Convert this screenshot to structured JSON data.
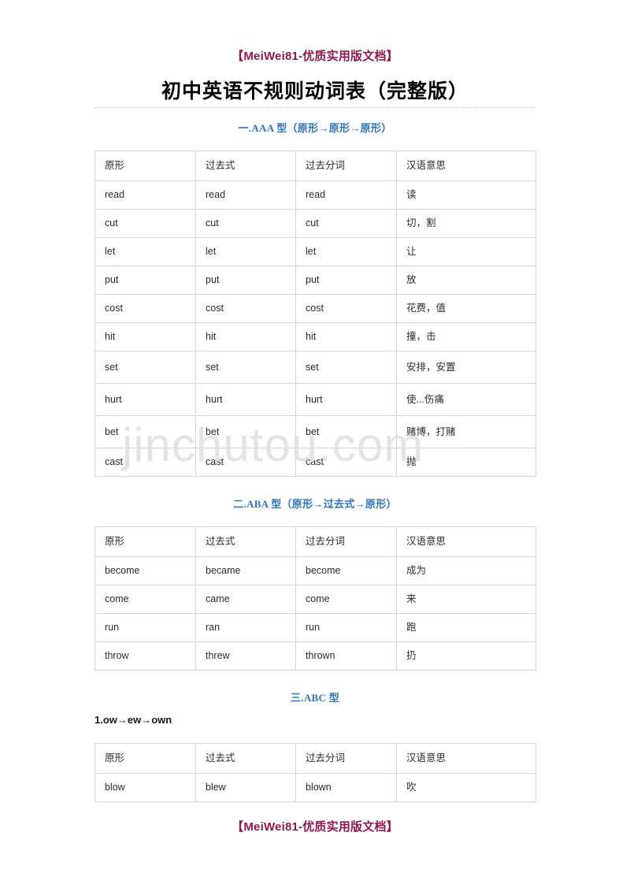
{
  "banner": {
    "top": "【MeiWei81-优质实用版文档】",
    "bottom": "【MeiWei81-优质实用版文档】"
  },
  "document": {
    "title": "初中英语不规则动词表（完整版）"
  },
  "watermark": {
    "text": "jinchutou.com",
    "color": "#e6e2e2"
  },
  "colors": {
    "banner": "#8C1A4F",
    "section_heading": "#2E74B5",
    "table_border": "#d4d4d4",
    "body_text": "#2b2b2b"
  },
  "table_headers": [
    "原形",
    "过去式",
    "过去分词",
    "汉语意思"
  ],
  "sections": [
    {
      "heading": "一.AAA 型（原形→原形→原形）",
      "subheading": null,
      "rows": [
        [
          "read",
          "read",
          "read",
          "读"
        ],
        [
          "cut",
          "cut",
          "cut",
          "切，割"
        ],
        [
          "let",
          "let",
          "let",
          "让"
        ],
        [
          "put",
          "put",
          "put",
          "放"
        ],
        [
          "cost",
          "cost",
          "cost",
          "花费，值"
        ],
        [
          "hit",
          "hit",
          "hit",
          "撞，击"
        ],
        [
          "set",
          "set",
          "set",
          "安排，安置"
        ],
        [
          "hurt",
          "hurt",
          "hurt",
          "使...伤痛"
        ],
        [
          "bet",
          "bet",
          "bet",
          "赌博，打赌"
        ],
        [
          "cast",
          "cast",
          "cast",
          "抛"
        ]
      ]
    },
    {
      "heading": "二.ABA 型（原形→过去式→原形）",
      "subheading": null,
      "rows": [
        [
          "become",
          "became",
          "become",
          "成为"
        ],
        [
          "come",
          "came",
          "come",
          "来"
        ],
        [
          "run",
          "ran",
          "run",
          "跑"
        ],
        [
          "throw",
          "threw",
          "thrown",
          "扔"
        ]
      ]
    },
    {
      "heading": "三.ABC 型",
      "subheading": "1.ow→ew→own",
      "rows": [
        [
          "blow",
          "blew",
          "blown",
          "吹"
        ]
      ]
    }
  ]
}
